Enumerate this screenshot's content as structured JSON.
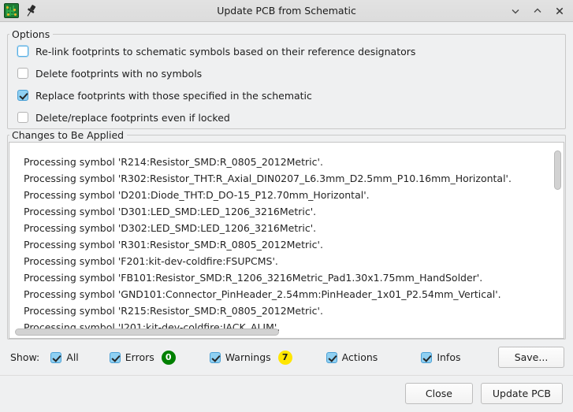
{
  "window": {
    "title": "Update PCB from Schematic",
    "app_icon": "pcb-board-icon",
    "pin_icon": "pushpin-icon",
    "controls": [
      {
        "name": "minimize-button",
        "icon": "chevron-down-icon"
      },
      {
        "name": "maximize-button",
        "icon": "chevron-up-icon"
      },
      {
        "name": "close-button",
        "icon": "close-x-icon"
      }
    ]
  },
  "options": {
    "legend": "Options",
    "items": [
      {
        "label": "Re-link footprints to schematic symbols based on their reference designators",
        "checked": false,
        "focused": true
      },
      {
        "label": "Delete footprints with no symbols",
        "checked": false,
        "focused": false
      },
      {
        "label": "Replace footprints with those specified in the schematic",
        "checked": true,
        "focused": false
      },
      {
        "label": "Delete/replace footprints even if locked",
        "checked": false,
        "focused": false
      }
    ]
  },
  "changes": {
    "legend": "Changes to Be Applied",
    "lines": [
      "Processing symbol 'R214:Resistor_SMD:R_0805_2012Metric'.",
      "Processing symbol 'R302:Resistor_THT:R_Axial_DIN0207_L6.3mm_D2.5mm_P10.16mm_Horizontal'.",
      "Processing symbol 'D201:Diode_THT:D_DO-15_P12.70mm_Horizontal'.",
      "Processing symbol 'D301:LED_SMD:LED_1206_3216Metric'.",
      "Processing symbol 'D302:LED_SMD:LED_1206_3216Metric'.",
      "Processing symbol 'R301:Resistor_SMD:R_0805_2012Metric'.",
      "Processing symbol 'F201:kit-dev-coldfire:FSUPCMS'.",
      "Processing symbol 'FB101:Resistor_SMD:R_1206_3216Metric_Pad1.30x1.75mm_HandSolder'.",
      "Processing symbol 'GND101:Connector_PinHeader_2.54mm:PinHeader_1x01_P2.54mm_Vertical'.",
      "Processing symbol 'R215:Resistor_SMD:R_0805_2012Metric'.",
      "Processing symbol 'J201:kit-dev-coldfire:JACK_ALIM'."
    ]
  },
  "filters": {
    "show_label": "Show:",
    "items": [
      {
        "label": "All",
        "checked": true,
        "badge": null,
        "badge_bg": null,
        "badge_fg": null
      },
      {
        "label": "Errors",
        "checked": true,
        "badge": "0",
        "badge_bg": "#008000",
        "badge_fg": "#ffffff"
      },
      {
        "label": "Warnings",
        "checked": true,
        "badge": "7",
        "badge_bg": "#ffe600",
        "badge_fg": "#1a1a1a"
      },
      {
        "label": "Actions",
        "checked": true,
        "badge": null,
        "badge_bg": null,
        "badge_fg": null
      },
      {
        "label": "Infos",
        "checked": true,
        "badge": null,
        "badge_bg": null,
        "badge_fg": null
      }
    ],
    "save_label": "Save..."
  },
  "footer": {
    "close_label": "Close",
    "update_label": "Update PCB"
  }
}
